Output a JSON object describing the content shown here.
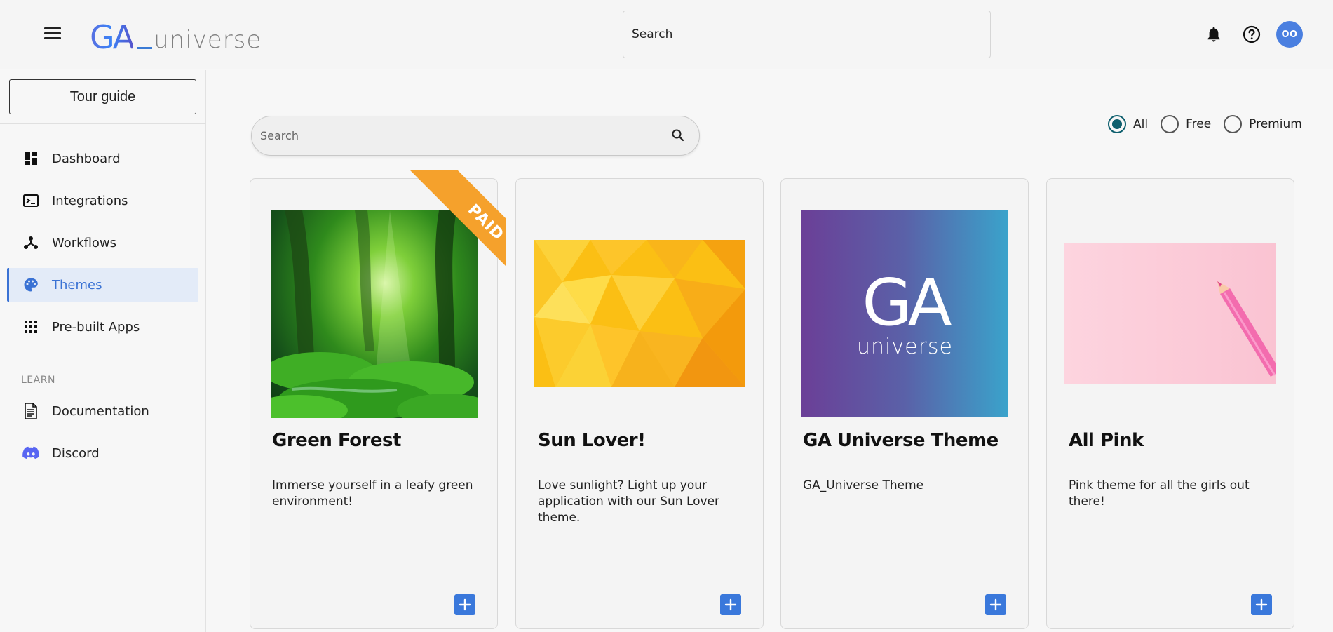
{
  "header": {
    "logo_ga": "GA",
    "logo_text": "universe",
    "search_placeholder": "Search",
    "avatar_initials": "OO",
    "icons": [
      "menu-icon",
      "bell-icon",
      "help-icon"
    ]
  },
  "sidebar": {
    "tour_label": "Tour guide",
    "items": [
      {
        "label": "Dashboard",
        "icon": "dashboard-icon"
      },
      {
        "label": "Integrations",
        "icon": "terminal-icon"
      },
      {
        "label": "Workflows",
        "icon": "workflow-icon"
      },
      {
        "label": "Themes",
        "icon": "palette-icon",
        "active": true
      },
      {
        "label": "Pre-built Apps",
        "icon": "apps-grid-icon"
      }
    ],
    "learn_label": "LEARN",
    "learn_items": [
      {
        "label": "Documentation",
        "icon": "document-icon"
      },
      {
        "label": "Discord",
        "icon": "discord-icon"
      }
    ]
  },
  "main": {
    "search_placeholder": "Search",
    "filters": {
      "options": [
        "All",
        "Free",
        "Premium"
      ],
      "selected": "All"
    },
    "cards": [
      {
        "title": "Green Forest",
        "description": "Immerse yourself in a leafy green environment!",
        "badge": "PAID"
      },
      {
        "title": "Sun Lover!",
        "description": "Love sunlight? Light up your application with our Sun Lover theme."
      },
      {
        "title": "GA Universe Theme",
        "description": "GA_Universe Theme",
        "image_text_top": "GA",
        "image_text_bottom": "universe"
      },
      {
        "title": "All Pink",
        "description": "Pink theme for all the girls out there!"
      }
    ]
  },
  "colors": {
    "accent": "#3a72d4",
    "radio_selected": "#0e5f6e",
    "paid_ribbon": "#f5a12c",
    "add_button": "#3a78db"
  }
}
